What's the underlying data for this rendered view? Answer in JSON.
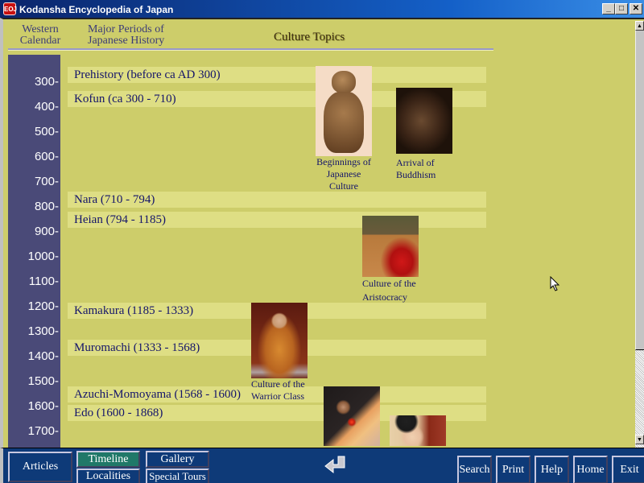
{
  "window": {
    "title": "Kodansha Encyclopedia of Japan",
    "icon": "encyclopedia-app-icon",
    "icon_label": "EOJ",
    "controls": {
      "minimize": "_",
      "maximize": "□",
      "close": "✕"
    }
  },
  "header": {
    "western_calendar": [
      "Western",
      "Calendar"
    ],
    "major_periods": [
      "Major Periods of",
      "Japanese History"
    ],
    "culture_topics": "Culture Topics"
  },
  "axis_ticks": [
    "300-",
    "400-",
    "500-",
    "600-",
    "700-",
    "800-",
    "900-",
    "1000-",
    "1100-",
    "1200-",
    "1300-",
    "1400-",
    "1500-",
    "1600-",
    "1700-"
  ],
  "periods": [
    {
      "label": "Prehistory (before ca AD 300)"
    },
    {
      "label": "Kofun (ca 300 - 710)"
    },
    {
      "label": "Nara (710 - 794)"
    },
    {
      "label": "Heian (794 - 1185)"
    },
    {
      "label": "Kamakura (1185 - 1333)"
    },
    {
      "label": "Muromachi (1333 - 1568)"
    },
    {
      "label": "Azuchi-Momoyama (1568 - 1600)"
    },
    {
      "label": "Edo (1600 - 1868)"
    }
  ],
  "topics": [
    {
      "caption": [
        "Beginnings of",
        "Japanese",
        "Culture"
      ],
      "image": "dogu-figurine-image"
    },
    {
      "caption": [
        "Arrival of",
        "Buddhism"
      ],
      "image": "buddha-statue-image"
    },
    {
      "caption": [
        "Culture of the",
        "Aristocracy"
      ],
      "image": "heian-court-lady-image"
    },
    {
      "caption": [
        "Culture of the",
        "Warrior Class"
      ],
      "image": "warrior-portrait-image"
    },
    {
      "caption": [],
      "image": "jesuit-missionary-image"
    },
    {
      "caption": [],
      "image": "ukiyoe-woman-image"
    }
  ],
  "nav": {
    "articles": "Articles",
    "timeline": "Timeline",
    "gallery": "Gallery",
    "localities": "Localities",
    "special_tours": "Special Tours",
    "back": "back-arrow-icon",
    "search": "Search",
    "print": "Print",
    "help": "Help",
    "home": "Home",
    "exit": "Exit",
    "active": "Timeline"
  },
  "colors": {
    "background": "#cdcd6a",
    "axis": "#4a4a78",
    "period_bar": "#dede84",
    "nav_bg": "#0e3a78",
    "nav_active": "#207868",
    "text": "#14146a"
  }
}
